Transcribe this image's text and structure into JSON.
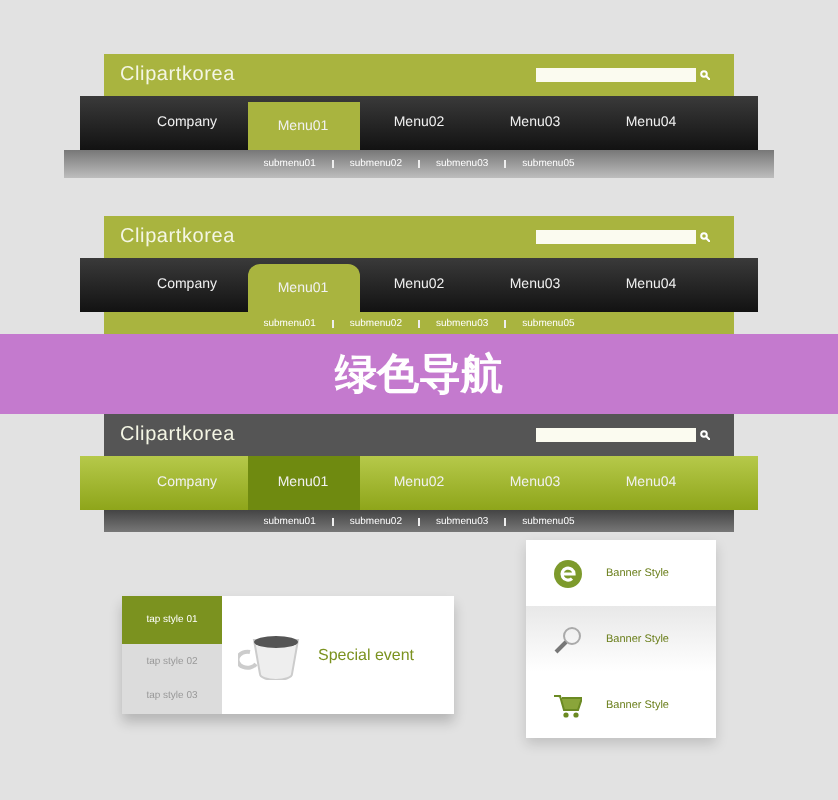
{
  "navs": [
    {
      "kind": "flat",
      "logo": "Clipartkorea",
      "menus": [
        {
          "label": "Company",
          "selected": false
        },
        {
          "label": "Menu01",
          "selected": true
        },
        {
          "label": "Menu02",
          "selected": false
        },
        {
          "label": "Menu03",
          "selected": false
        },
        {
          "label": "Menu04",
          "selected": false
        }
      ],
      "submenus": [
        "submenu01",
        "submenu02",
        "submenu03",
        "submenu05"
      ]
    },
    {
      "kind": "tab",
      "logo": "Clipartkorea",
      "menus": [
        {
          "label": "Company",
          "selected": false
        },
        {
          "label": "Menu01",
          "selected": true
        },
        {
          "label": "Menu02",
          "selected": false
        },
        {
          "label": "Menu03",
          "selected": false
        },
        {
          "label": "Menu04",
          "selected": false
        }
      ],
      "submenus": [
        "submenu01",
        "submenu02",
        "submenu03",
        "submenu05"
      ]
    },
    {
      "kind": "inverted",
      "logo": "Clipartkorea",
      "menus": [
        {
          "label": "Company",
          "selected": false
        },
        {
          "label": "Menu01",
          "selected": true
        },
        {
          "label": "Menu02",
          "selected": false
        },
        {
          "label": "Menu03",
          "selected": false
        },
        {
          "label": "Menu04",
          "selected": false
        }
      ],
      "submenus": [
        "submenu01",
        "submenu02",
        "submenu03",
        "submenu05"
      ]
    }
  ],
  "banner": {
    "title": "绿色导航"
  },
  "tab_card": {
    "tabs": [
      {
        "label": "tap style 01",
        "selected": true
      },
      {
        "label": "tap style 02",
        "selected": false
      },
      {
        "label": "tap style 03",
        "selected": false
      }
    ],
    "title": "Special event"
  },
  "banner_list": {
    "items": [
      {
        "kind": "e",
        "title": "Banner Style"
      },
      {
        "kind": "magnifier",
        "title": "Banner Style"
      },
      {
        "kind": "cart",
        "title": "Banner Style"
      }
    ]
  }
}
